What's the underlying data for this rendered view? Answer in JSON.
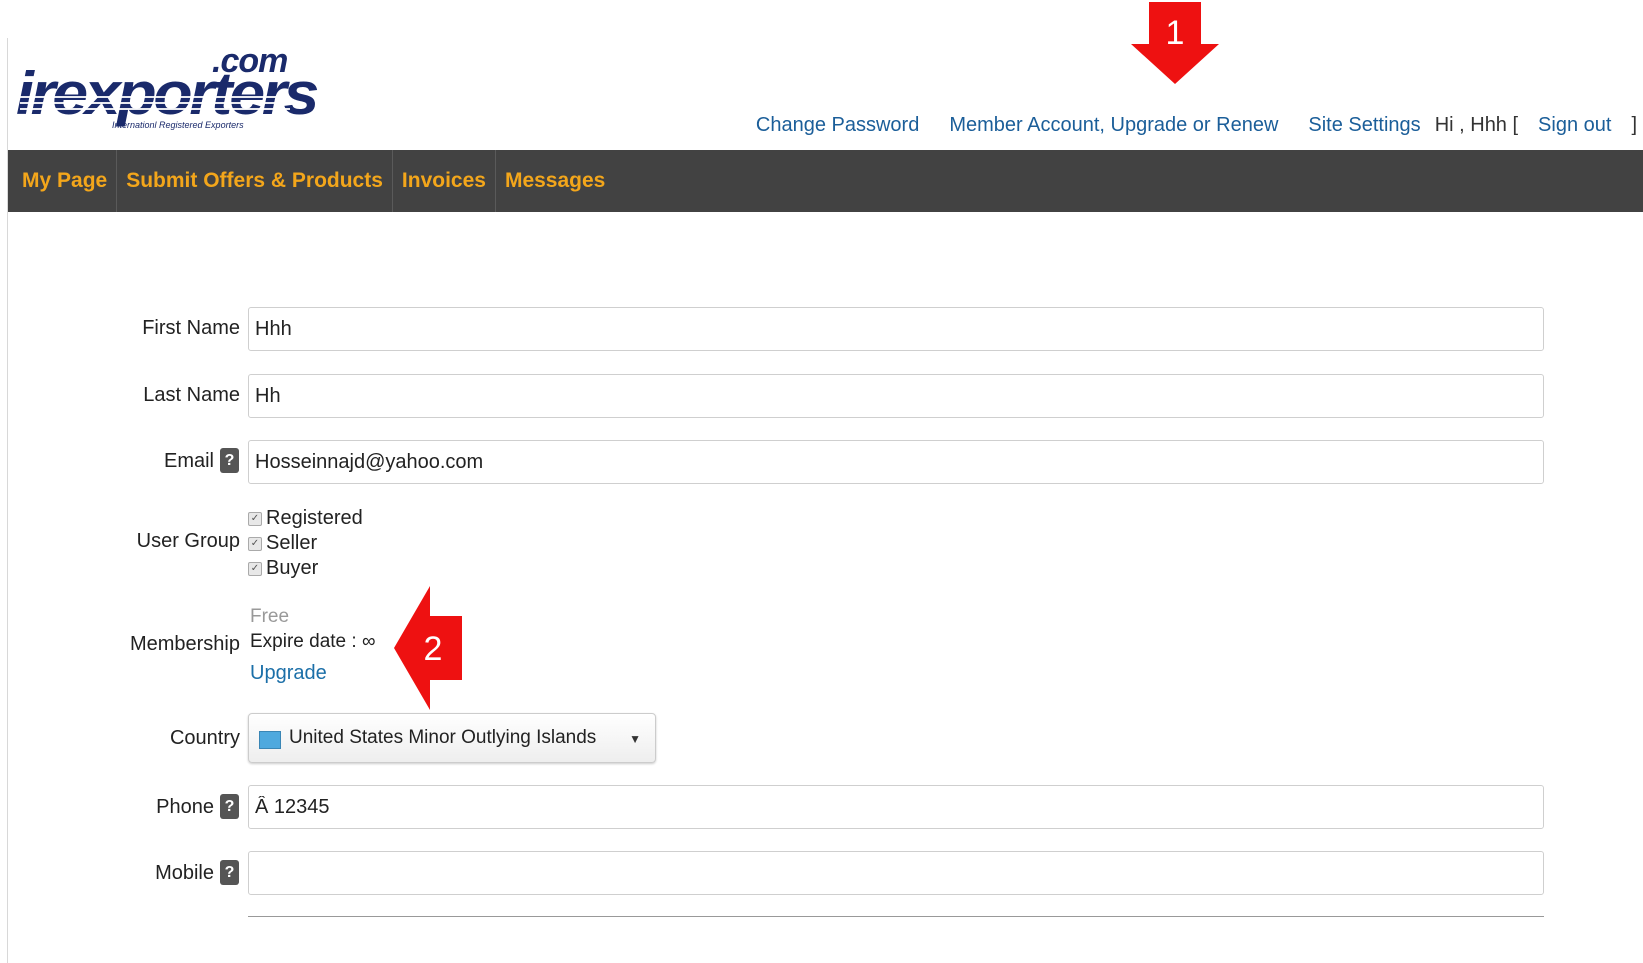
{
  "logo": {
    "domain": ".com",
    "word": "irexporters",
    "tagline": "Internationl Registered Exporters"
  },
  "top_links": {
    "change_password": "Change Password",
    "member_account": "Member Account, Upgrade or Renew",
    "site_settings": "Site Settings",
    "greeting": "Hi , Hhh [",
    "sign_out": "Sign out",
    "close_bracket": "]"
  },
  "nav": {
    "items": [
      "My Page",
      "Submit Offers & Products",
      "Invoices",
      "Messages"
    ]
  },
  "form": {
    "first_name": {
      "label": "First Name",
      "value": "Hhh"
    },
    "last_name": {
      "label": "Last Name",
      "value": "Hh"
    },
    "email": {
      "label": "Email",
      "value": "Hosseinnajd@yahoo.com",
      "help": "?"
    },
    "user_group": {
      "label": "User Group",
      "options": [
        {
          "label": "Registered",
          "checked": true
        },
        {
          "label": "Seller",
          "checked": true
        },
        {
          "label": "Buyer",
          "checked": true
        }
      ]
    },
    "membership": {
      "label": "Membership",
      "plan": "Free",
      "expire": "Expire date : ∞",
      "upgrade_link": "Upgrade"
    },
    "country": {
      "label": "Country",
      "value": "United States Minor Outlying Islands",
      "caret": "▼"
    },
    "phone": {
      "label": "Phone",
      "value": "Â 12345",
      "help": "?"
    },
    "mobile": {
      "label": "Mobile",
      "value": "",
      "help": "?"
    }
  },
  "annotations": [
    {
      "number": "1",
      "color": "#ee1111"
    },
    {
      "number": "2",
      "color": "#ee1111"
    }
  ]
}
